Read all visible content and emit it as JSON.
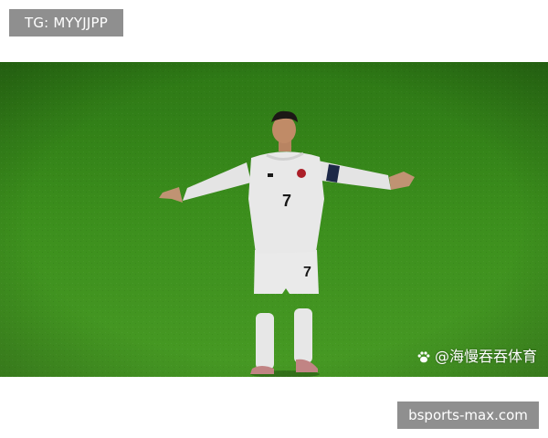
{
  "header": {
    "tg_label": "TG: MYYJJPP"
  },
  "photo": {
    "icon": "paw-icon",
    "watermark_text": "@海慢吞吞体育",
    "jersey_number": "7"
  },
  "footer": {
    "site_label": "bsports-max.com"
  }
}
